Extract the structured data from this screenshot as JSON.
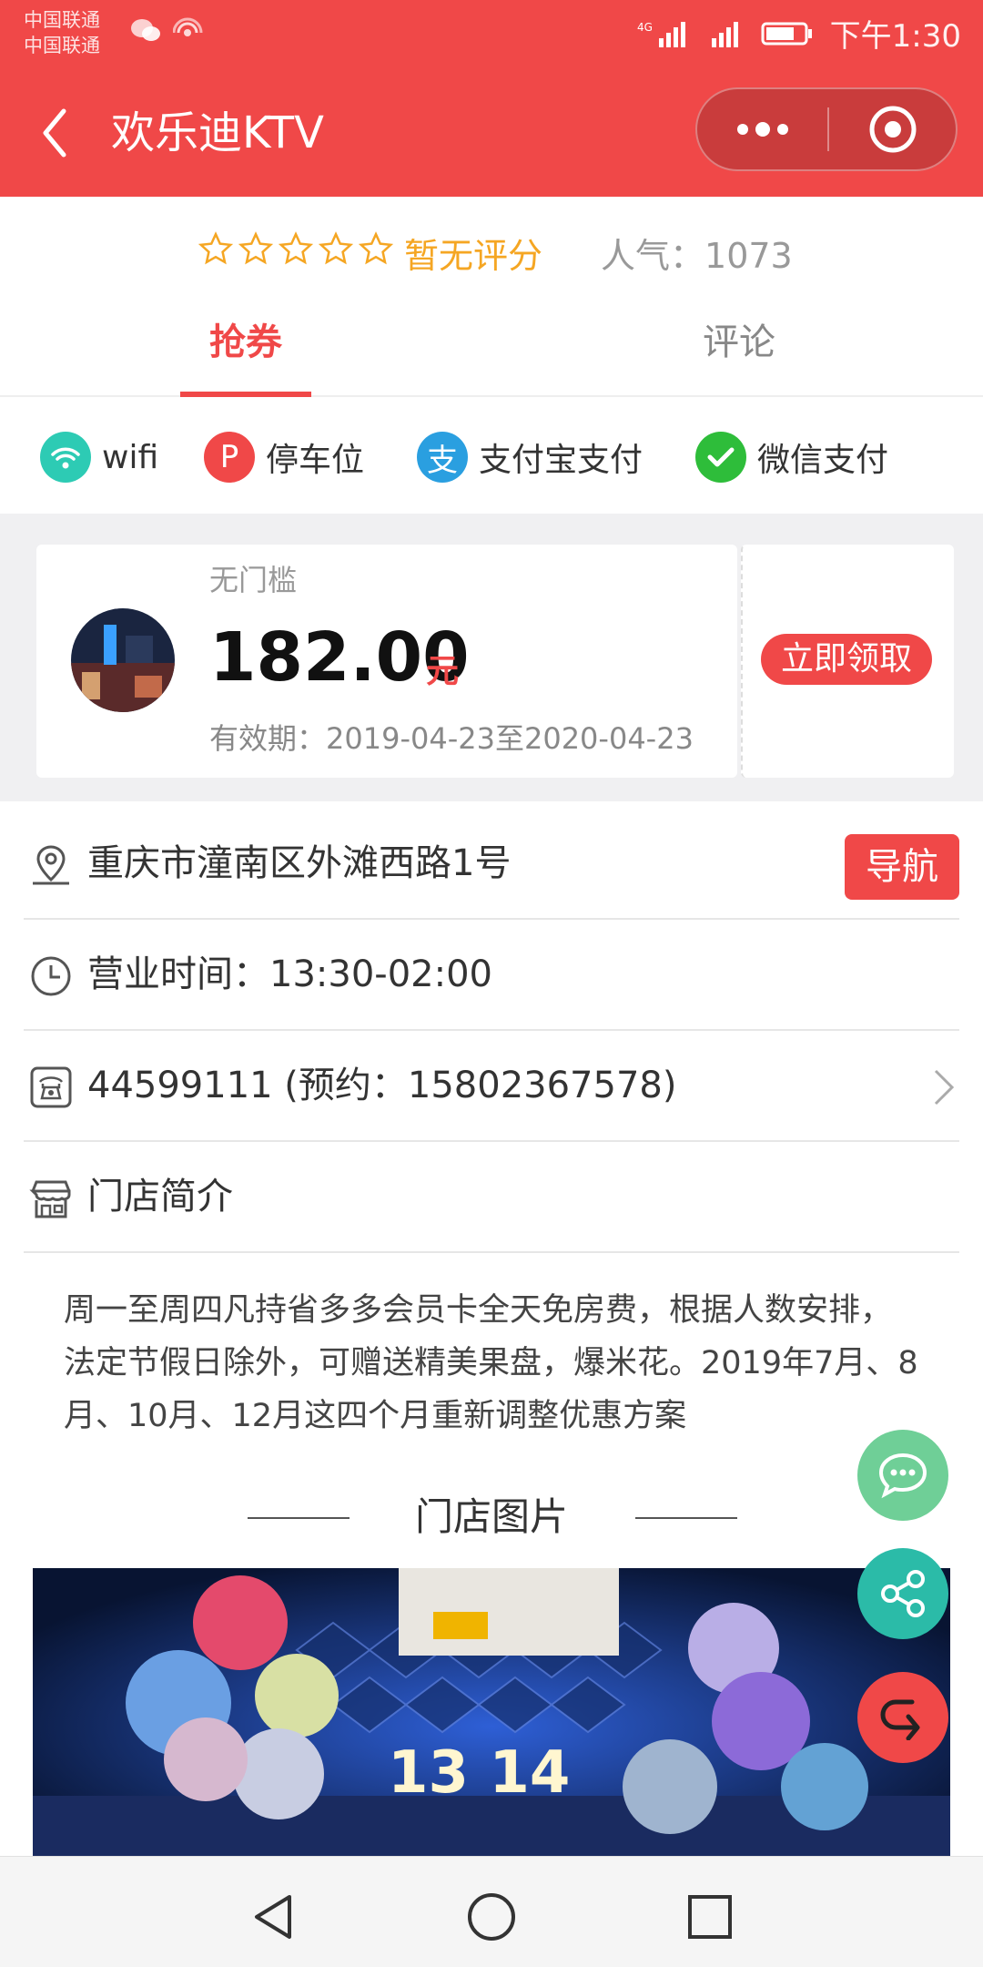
{
  "status_bar": {
    "carrier_1": "中国联通",
    "carrier_2": "中国联通",
    "network": "4G",
    "time": "下午1:30",
    "icons": [
      "wechat-icon",
      "hotspot-icon",
      "signal-icon",
      "battery-icon"
    ]
  },
  "header": {
    "title": "欢乐迪KTV",
    "back_icon": "back-arrow-icon",
    "more_icon": "more-dots-icon",
    "close_icon": "target-close-icon",
    "color": "#f04848"
  },
  "rating": {
    "stars_total": 5,
    "stars_filled": 0,
    "text": "暂无评分",
    "popularity_label": "人气：",
    "popularity_value": "1073"
  },
  "tabs": [
    {
      "label": "抢券",
      "active": true
    },
    {
      "label": "评论",
      "active": false
    }
  ],
  "amenities": [
    {
      "label": "wifi",
      "icon": "wifi-icon",
      "color": "#2dcbb4"
    },
    {
      "label": "停车位",
      "icon": "parking-icon",
      "color": "#f04848"
    },
    {
      "label": "支付宝支付",
      "icon": "alipay-icon",
      "color": "#2a9fe0"
    },
    {
      "label": "微信支付",
      "icon": "wechat-pay-icon",
      "color": "#2ebd3a"
    }
  ],
  "coupon": {
    "threshold": "无门槛",
    "amount": "182.00",
    "unit": "元",
    "validity": "有效期：2019-04-23至2020-04-23",
    "claim_label": "立即领取"
  },
  "info": {
    "address": "重庆市潼南区外滩西路1号",
    "nav_label": "导航",
    "hours": "营业时间：13:30-02:00",
    "phone": "44599111 (预约：15802367578)",
    "intro_title": "门店简介"
  },
  "description": "周一至周四凡持省多多会员卡全天免房费，根据人数安排，法定节假日除外，可赠送精美果盘，爆米花。2019年7月、8月、10月、12月这四个月重新调整优惠方案",
  "photos_section": {
    "title": "门店图片",
    "photo_text": "13 14"
  },
  "floating_buttons": [
    {
      "icon": "chat-icon",
      "color": "#6fcf97"
    },
    {
      "icon": "share-icon",
      "color": "#2bbba8"
    },
    {
      "icon": "return-icon",
      "color": "#f04848"
    }
  ],
  "nav_bar": [
    "back-triangle-icon",
    "home-circle-icon",
    "recents-square-icon"
  ]
}
